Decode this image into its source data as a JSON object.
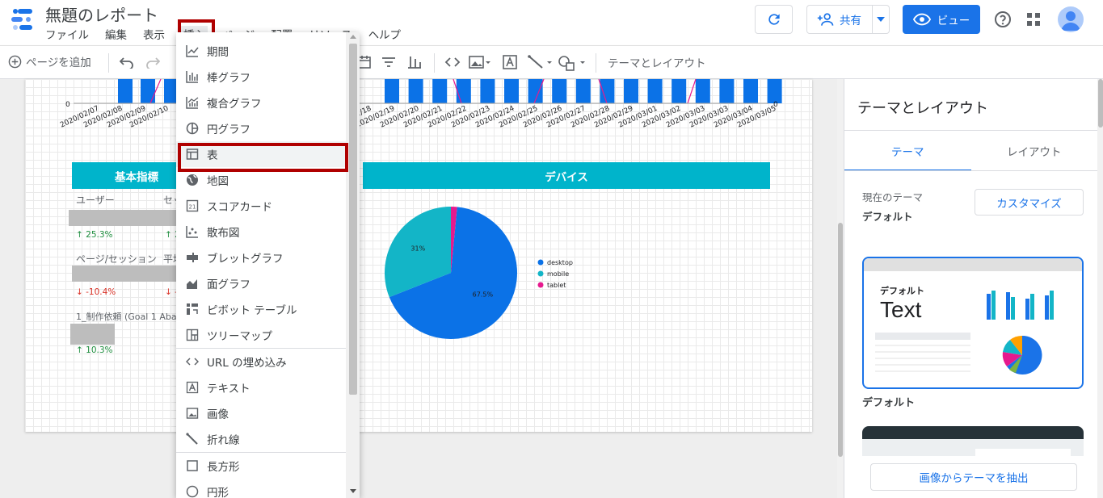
{
  "header": {
    "title": "無題のレポート",
    "menu": [
      "ファイル",
      "編集",
      "表示",
      "挿入",
      "ページ",
      "配置",
      "リソース",
      "ヘルプ"
    ],
    "share_label": "共有",
    "view_label": "ビュー"
  },
  "toolbar": {
    "add_page_label": "ページを追加",
    "theme_layout_label": "テーマとレイアウト"
  },
  "insert_menu": {
    "items": [
      {
        "label": "期間",
        "icon": "timeseries-icon"
      },
      {
        "label": "棒グラフ",
        "icon": "bar-chart-icon"
      },
      {
        "label": "複合グラフ",
        "icon": "combo-chart-icon"
      },
      {
        "label": "円グラフ",
        "icon": "pie-chart-icon"
      },
      {
        "label": "表",
        "icon": "table-icon"
      },
      {
        "label": "地図",
        "icon": "globe-icon"
      },
      {
        "label": "スコアカード",
        "icon": "scorecard-icon"
      },
      {
        "label": "散布図",
        "icon": "scatter-icon"
      },
      {
        "label": "ブレットグラフ",
        "icon": "bullet-chart-icon"
      },
      {
        "label": "面グラフ",
        "icon": "area-chart-icon"
      },
      {
        "label": "ピボット テーブル",
        "icon": "pivot-table-icon"
      },
      {
        "label": "ツリーマップ",
        "icon": "treemap-icon"
      },
      {
        "label": "URL の埋め込み",
        "icon": "embed-code-icon"
      },
      {
        "label": "テキスト",
        "icon": "text-box-icon"
      },
      {
        "label": "画像",
        "icon": "image-icon"
      },
      {
        "label": "折れ線",
        "icon": "line-icon"
      },
      {
        "label": "長方形",
        "icon": "rectangle-icon"
      },
      {
        "label": "円形",
        "icon": "circle-icon"
      }
    ]
  },
  "canvas": {
    "dates": [
      "2020/02/07",
      "2020/02/08",
      "2020/02/09",
      "2020/02/10",
      "2020/02/18",
      "2020/02/19",
      "2020/02/20",
      "2020/02/21",
      "2020/02/22",
      "2020/02/23",
      "2020/02/24",
      "2020/02/25",
      "2020/02/26",
      "2020/02/27",
      "2020/02/28",
      "2020/02/29",
      "2020/03/01",
      "2020/03/02",
      "2020/03/03",
      "2020/03/03",
      "2020/03/04",
      "2020/03/05"
    ],
    "axis_zero": "0",
    "basic_panel": {
      "title": "基本指標",
      "users_label": "ユーザー",
      "sessions_label": "セッション",
      "users_delta": "25.3%",
      "sessions_delta": "2",
      "pps_label": "ページ/セッション",
      "avg_label": "平均",
      "pps_delta": "-10.4%",
      "avg_delta": "-",
      "goal_label": "1_制作依頼 (Goal 1 Aban",
      "goal_delta": "10.3%"
    },
    "device_panel": {
      "title": "デバイス"
    }
  },
  "chart_data": {
    "type": "pie",
    "title": "デバイス",
    "categories": [
      "desktop",
      "mobile",
      "tablet"
    ],
    "values": [
      67.5,
      31,
      1.5
    ],
    "labels": [
      "67.5%",
      "31%",
      ""
    ],
    "colors": [
      "#0b72e7",
      "#13b5c7",
      "#e6198e"
    ],
    "legend": "right"
  },
  "right_panel": {
    "title": "テーマとレイアウト",
    "tab_theme": "テーマ",
    "tab_layout": "レイアウト",
    "current_theme_label": "現在のテーマ",
    "current_theme_value": "デフォルト",
    "customize_label": "カスタマイズ",
    "card_label": "デフォルト",
    "card_text": "Text",
    "theme_name": "デフォルト",
    "extract_label": "画像からテーマを抽出"
  }
}
